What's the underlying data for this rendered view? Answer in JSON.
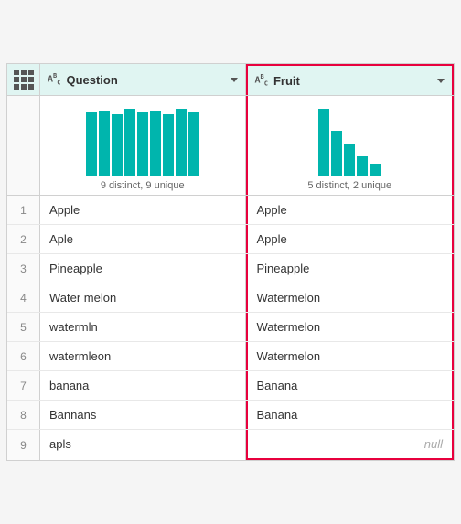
{
  "header": {
    "col1": {
      "label": "Question",
      "icon": "ABC"
    },
    "col2": {
      "label": "Fruit",
      "icon": "ABC"
    }
  },
  "summary": {
    "col1": {
      "text": "9 distinct, 9 unique",
      "bars": [
        70,
        72,
        68,
        74,
        70,
        72,
        68,
        74,
        70
      ]
    },
    "col2": {
      "text": "5 distinct, 2 unique",
      "bars": [
        74,
        50,
        35,
        25,
        15
      ]
    }
  },
  "rows": [
    {
      "num": "1",
      "question": "Apple",
      "fruit": "Apple"
    },
    {
      "num": "2",
      "question": "Aple",
      "fruit": "Apple"
    },
    {
      "num": "3",
      "question": "Pineapple",
      "fruit": "Pineapple"
    },
    {
      "num": "4",
      "question": "Water melon",
      "fruit": "Watermelon"
    },
    {
      "num": "5",
      "question": "watermln",
      "fruit": "Watermelon"
    },
    {
      "num": "6",
      "question": "watermleon",
      "fruit": "Watermelon"
    },
    {
      "num": "7",
      "question": "banana",
      "fruit": "Banana"
    },
    {
      "num": "8",
      "question": "Bannans",
      "fruit": "Banana"
    },
    {
      "num": "9",
      "question": "apls",
      "fruit": null
    }
  ]
}
